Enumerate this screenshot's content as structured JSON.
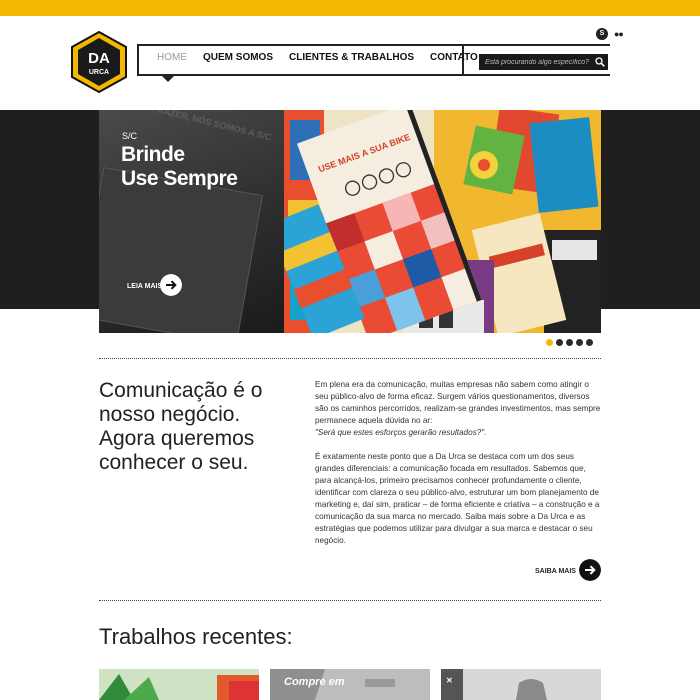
{
  "brand": {
    "logo_text": "DA URCA"
  },
  "nav": {
    "items": [
      "HOME",
      "QUEM SOMOS",
      "CLIENTES & TRABALHOS",
      "CONTATO"
    ]
  },
  "search": {
    "placeholder": "Está procurando algo específico?"
  },
  "social": {
    "icon_a": "skype-icon",
    "icon_b": "flickr-icon"
  },
  "slide": {
    "eyebrow": "S/C",
    "title_line1": "Brinde",
    "title_line2": "Use Sempre",
    "cta": "LEIA MAIS",
    "background_text": "MUITO PRAZER, NÓS SOMOS A S/C",
    "photo_text": "USE MAIS A SUA BIKE"
  },
  "slider": {
    "count": 5,
    "active_index": 0
  },
  "intro": {
    "headline": "Comunicação é o nosso negócio. Agora queremos conhecer o seu.",
    "paragraph1": "Em plena era da comunicação, muitas empresas não sabem como atingir o seu público-alvo de forma eficaz. Surgem vários questionamentos, diversos são os caminhos percorridos, realizam-se grandes investimentos, mas sempre permanece aquela dúvida no ar:",
    "paragraph1_quote": "\"Será que estes esforços gerarão resultados?\".",
    "paragraph2": "É exatamente neste ponto que a Da Urca se destaca com um dos seus grandes diferenciais: a comunicação focada em resultados. Sabemos que, para alcançá-los, primeiro precisamos conhecer profundamente o cliente, identificar com clareza o seu público-alvo, estruturar um bom planejamento de marketing e, daí sim, praticar – de forma eficiente e criativa – a construção e a comunicação da sua marca no mercado. Saiba mais sobre a Da Urca e as estratégias que podemos utilizar para divulgar a sua marca e destacar o seu negócio.",
    "cta": "SAIBA MAIS"
  },
  "recent": {
    "title": "Trabalhos recentes:",
    "thumb2_text": "Compre em"
  },
  "colors": {
    "accent": "#f5b800",
    "dark": "#1f1f20"
  }
}
